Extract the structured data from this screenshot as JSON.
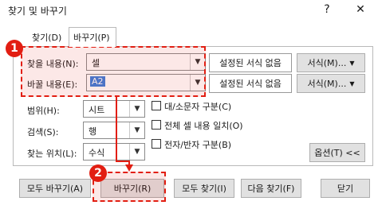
{
  "window": {
    "title": "찾기 및 바꾸기",
    "help": "?",
    "close": "✕"
  },
  "tabs": [
    {
      "label": "찾기(D)"
    },
    {
      "label": "바꾸기(P)"
    }
  ],
  "find": {
    "label": "찾을 내용(N):",
    "value": "셀",
    "format_status": "설정된 서식 없음",
    "format_button": "서식(M)..."
  },
  "replace": {
    "label": "바꿀 내용(E):",
    "value": "A2",
    "format_status": "설정된 서식 없음",
    "format_button": "서식(M)..."
  },
  "options": {
    "within": {
      "label": "범위(H):",
      "value": "시트"
    },
    "search": {
      "label": "검색(S):",
      "value": "행"
    },
    "look_in": {
      "label": "찾는 위치(L):",
      "value": "수식"
    },
    "match_case": "대/소문자 구분(C)",
    "match_entire": "전체 셀 내용 일치(O)",
    "match_byte": "전자/반자 구분(B)",
    "options_button": "옵션(T) <<"
  },
  "buttons": {
    "replace_all": "모두 바꾸기(A)",
    "replace": "바꾸기(R)",
    "find_all": "모두 찾기(I)",
    "find_next": "다음 찾기(F)",
    "close": "닫기"
  },
  "annotations": {
    "step1": "1",
    "step2": "2",
    "color": "#e21e12"
  }
}
